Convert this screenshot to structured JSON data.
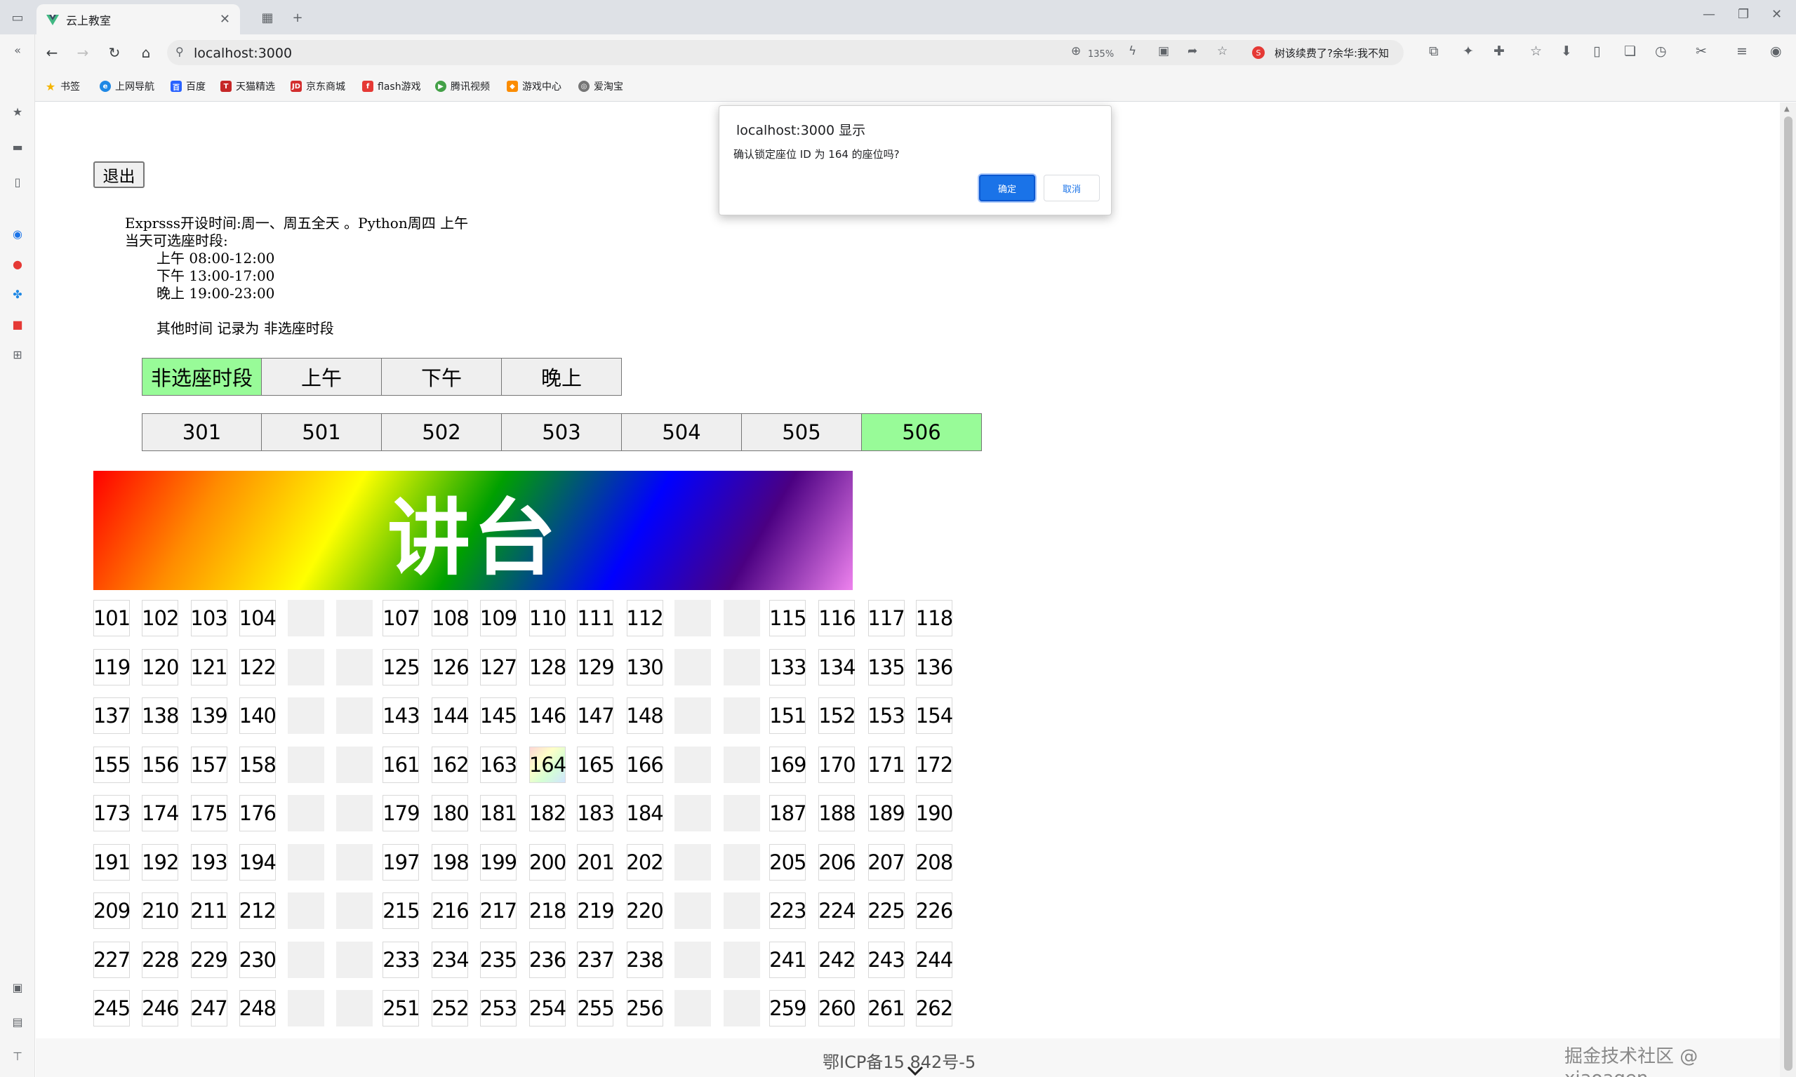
{
  "browser": {
    "tab_title": "云上教室",
    "url": "localhost:3000",
    "zoom": "135%",
    "news_headline": "树该续费了?余华:我不知",
    "bookmarks": [
      "书签",
      "上网导航",
      "百度",
      "天猫精选",
      "京东商城",
      "flash游戏",
      "腾讯视频",
      "游戏中心",
      "爱淘宝"
    ]
  },
  "page": {
    "logout_label": "退出",
    "schedule": {
      "line1": "Exprsss开设时间:周一、周五全天 。Python周四 上午",
      "line2": "当天可选座时段:",
      "slot_morning": "上午 08:00-12:00",
      "slot_afternoon": "下午 13:00-17:00",
      "slot_evening": "晚上 19:00-23:00",
      "note": "其他时间 记录为 非选座时段"
    },
    "time_slots": [
      {
        "label": "非选座时段",
        "active": true
      },
      {
        "label": "上午",
        "active": false
      },
      {
        "label": "下午",
        "active": false
      },
      {
        "label": "晚上",
        "active": false
      }
    ],
    "rooms": [
      {
        "label": "301",
        "active": false
      },
      {
        "label": "501",
        "active": false
      },
      {
        "label": "502",
        "active": false
      },
      {
        "label": "503",
        "active": false
      },
      {
        "label": "504",
        "active": false
      },
      {
        "label": "505",
        "active": false
      },
      {
        "label": "506",
        "active": true
      }
    ],
    "podium_label": "讲台",
    "seat_rows": [
      [
        "101",
        "102",
        "103",
        "104",
        "",
        "",
        "107",
        "108",
        "109",
        "110",
        "111",
        "112",
        "",
        "",
        "115",
        "116",
        "117",
        "118"
      ],
      [
        "119",
        "120",
        "121",
        "122",
        "",
        "",
        "125",
        "126",
        "127",
        "128",
        "129",
        "130",
        "",
        "",
        "133",
        "134",
        "135",
        "136"
      ],
      [
        "137",
        "138",
        "139",
        "140",
        "",
        "",
        "143",
        "144",
        "145",
        "146",
        "147",
        "148",
        "",
        "",
        "151",
        "152",
        "153",
        "154"
      ],
      [
        "155",
        "156",
        "157",
        "158",
        "",
        "",
        "161",
        "162",
        "163",
        "164",
        "165",
        "166",
        "",
        "",
        "169",
        "170",
        "171",
        "172"
      ],
      [
        "173",
        "174",
        "175",
        "176",
        "",
        "",
        "179",
        "180",
        "181",
        "182",
        "183",
        "184",
        "",
        "",
        "187",
        "188",
        "189",
        "190"
      ],
      [
        "191",
        "192",
        "193",
        "194",
        "",
        "",
        "197",
        "198",
        "199",
        "200",
        "201",
        "202",
        "",
        "",
        "205",
        "206",
        "207",
        "208"
      ],
      [
        "209",
        "210",
        "211",
        "212",
        "",
        "",
        "215",
        "216",
        "217",
        "218",
        "219",
        "220",
        "",
        "",
        "223",
        "224",
        "225",
        "226"
      ],
      [
        "227",
        "228",
        "229",
        "230",
        "",
        "",
        "233",
        "234",
        "235",
        "236",
        "237",
        "238",
        "",
        "",
        "241",
        "242",
        "243",
        "244"
      ],
      [
        "245",
        "246",
        "247",
        "248",
        "",
        "",
        "251",
        "252",
        "253",
        "254",
        "255",
        "256",
        "",
        "",
        "259",
        "260",
        "261",
        "262"
      ]
    ],
    "selected_seat": "164",
    "footer_icp": "鄂ICP备15   842号-5",
    "watermark": "掘金技术社区 @ xiaoagen"
  },
  "dialog": {
    "title": "localhost:3000 显示",
    "message": "确认锁定座位 ID 为 164 的座位吗?",
    "confirm_label": "确定",
    "cancel_label": "取消"
  },
  "colors": {
    "active_green": "#98fb98",
    "primary_blue": "#1a73e8"
  }
}
